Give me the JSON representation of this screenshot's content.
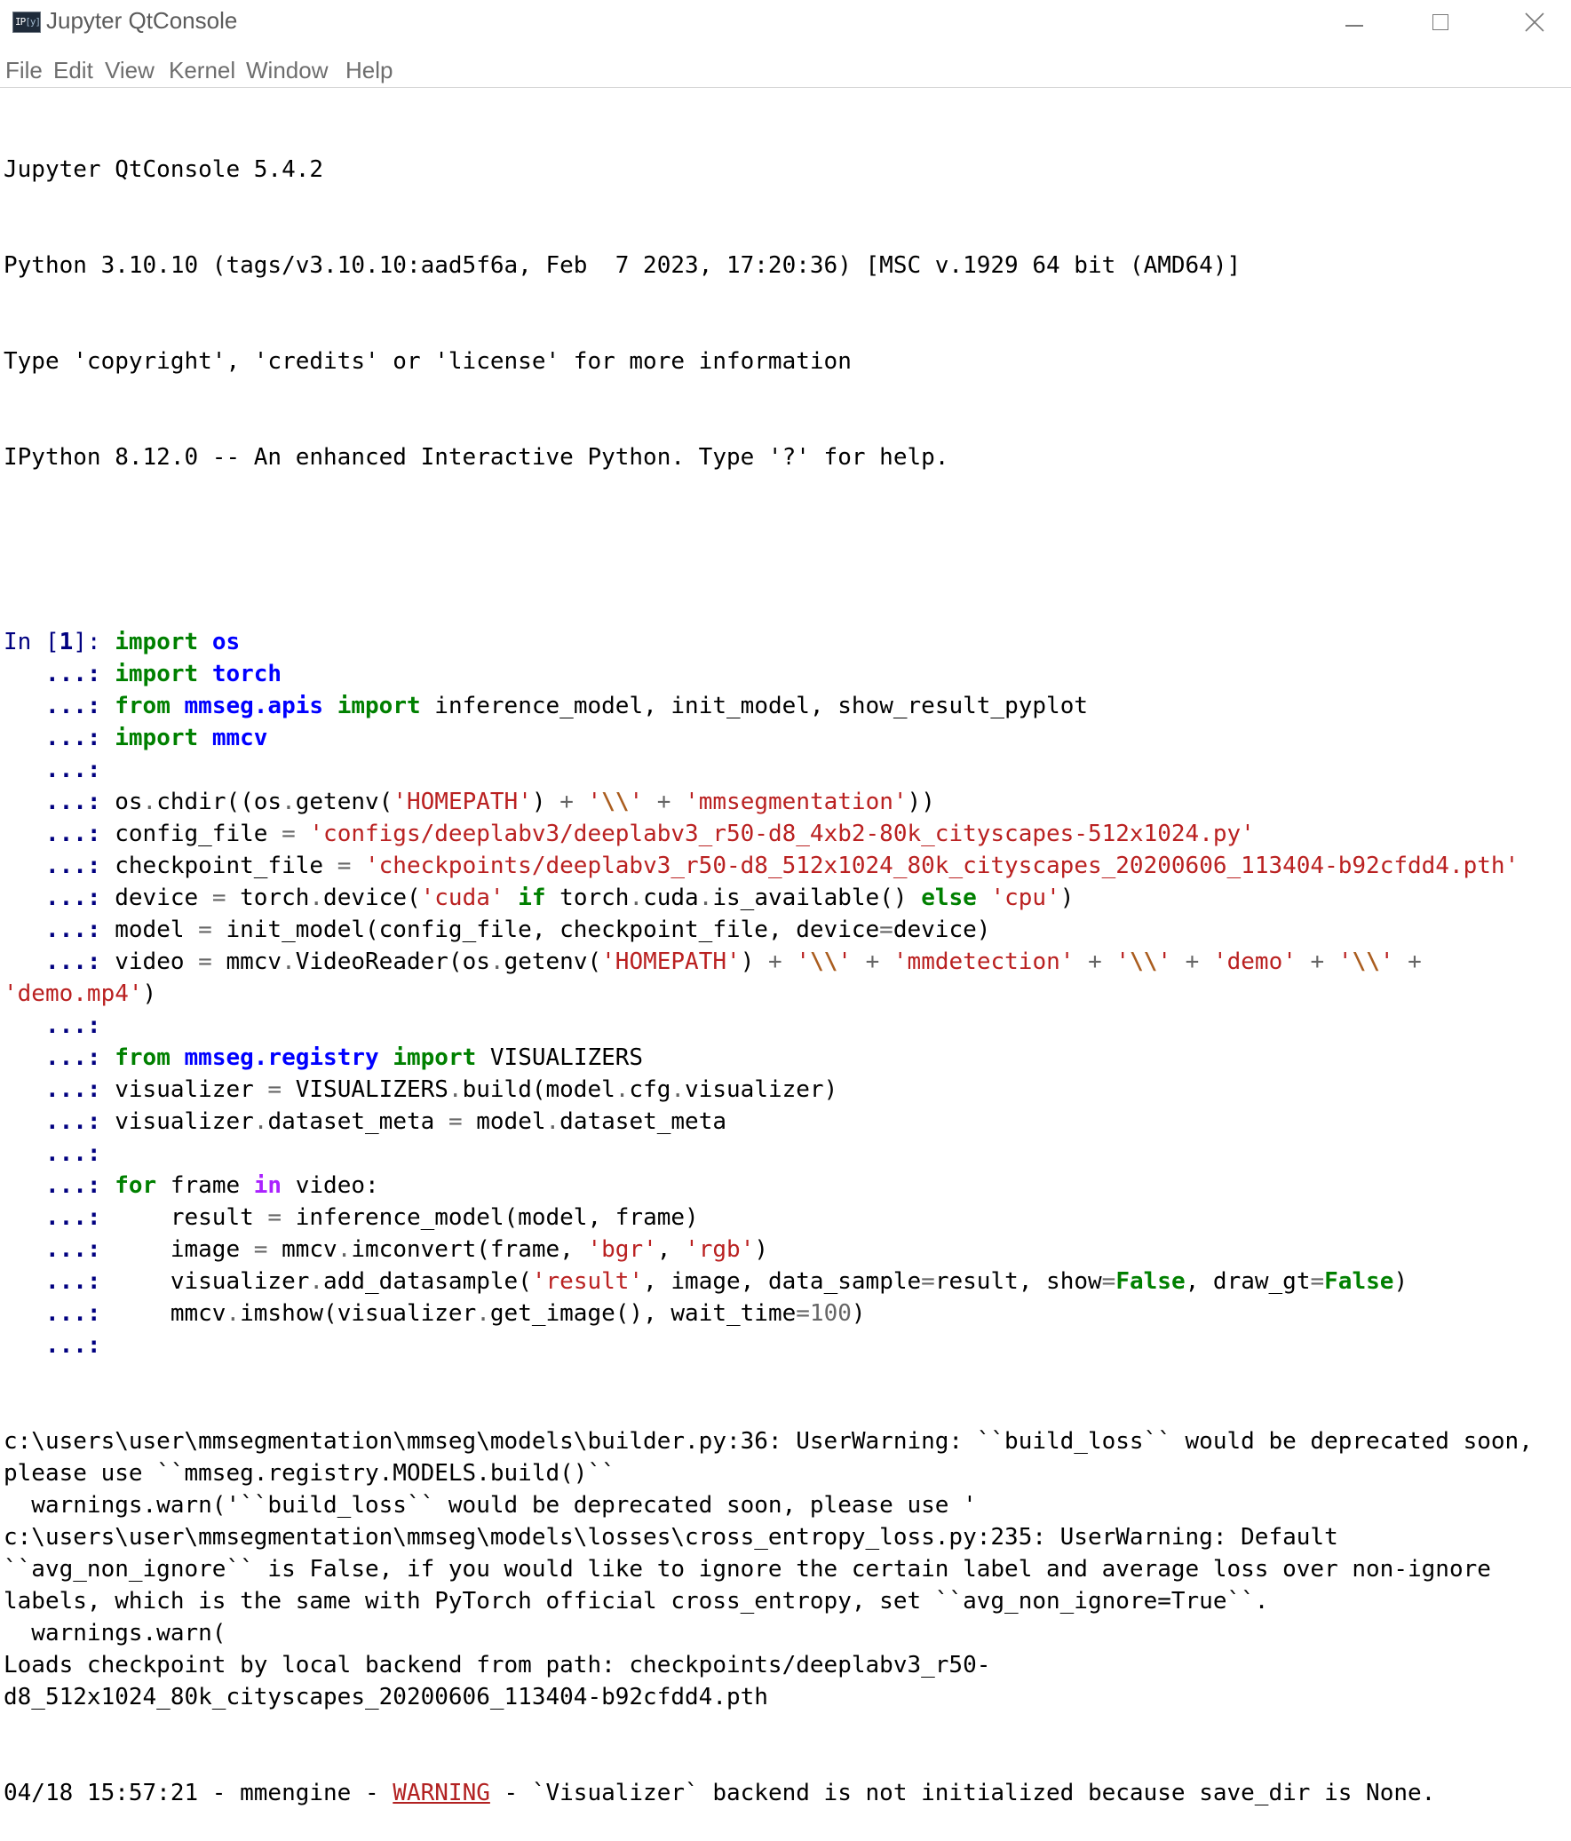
{
  "window": {
    "title": "Jupyter QtConsole",
    "icon_text": "IP",
    "icon_text_py": "[y]",
    "icon_name": "ipython-app-icon",
    "controls": [
      "minimize-icon",
      "maximize-icon",
      "close-icon"
    ]
  },
  "menu": {
    "items": [
      "File",
      "Edit",
      "View",
      "Kernel",
      "Window",
      "Help"
    ]
  },
  "banner": [
    "Jupyter QtConsole 5.4.2",
    "Python 3.10.10 (tags/v3.10.10:aad5f6a, Feb  7 2023, 17:20:36) [MSC v.1929 64 bit (AMD64)]",
    "Type 'copyright', 'credits' or 'license' for more information",
    "IPython 8.12.0 -- An enhanced Interactive Python. Type '?' for help."
  ],
  "prompt": {
    "in_label": "In [",
    "in_number": "1",
    "in_close": "]: ",
    "continuation": "   ...: "
  },
  "code_lines": [
    [
      [
        "kw",
        "import"
      ],
      [
        "t",
        " "
      ],
      [
        "nn",
        "os"
      ]
    ],
    [
      [
        "kw",
        "import"
      ],
      [
        "t",
        " "
      ],
      [
        "nn",
        "torch"
      ]
    ],
    [
      [
        "kw",
        "from"
      ],
      [
        "t",
        " "
      ],
      [
        "nn",
        "mmseg.apis"
      ],
      [
        "t",
        " "
      ],
      [
        "kw",
        "import"
      ],
      [
        "t",
        " inference_model, init_model, show_result_pyplot"
      ]
    ],
    [
      [
        "kw",
        "import"
      ],
      [
        "t",
        " "
      ],
      [
        "nn",
        "mmcv"
      ]
    ],
    [],
    [
      [
        "t",
        "os"
      ],
      [
        "o",
        "."
      ],
      [
        "t",
        "chdir((os"
      ],
      [
        "o",
        "."
      ],
      [
        "t",
        "getenv("
      ],
      [
        "s",
        "'HOMEPATH'"
      ],
      [
        "t",
        ") "
      ],
      [
        "o",
        "+"
      ],
      [
        "t",
        " "
      ],
      [
        "s",
        "'"
      ],
      [
        "se",
        "\\\\"
      ],
      [
        "s",
        "'"
      ],
      [
        "t",
        " "
      ],
      [
        "o",
        "+"
      ],
      [
        "t",
        " "
      ],
      [
        "s",
        "'mmsegmentation'"
      ],
      [
        "t",
        "))"
      ]
    ],
    [
      [
        "t",
        "config_file "
      ],
      [
        "o",
        "="
      ],
      [
        "t",
        " "
      ],
      [
        "s",
        "'configs/deeplabv3/deeplabv3_r50-d8_4xb2-80k_cityscapes-512x1024.py'"
      ]
    ],
    [
      [
        "t",
        "checkpoint_file "
      ],
      [
        "o",
        "="
      ],
      [
        "t",
        " "
      ],
      [
        "s",
        "'checkpoints/deeplabv3_r50-d8_512x1024_80k_cityscapes_20200606_113404-b92cfdd4.pth'"
      ]
    ],
    [
      [
        "t",
        "device "
      ],
      [
        "o",
        "="
      ],
      [
        "t",
        " torch"
      ],
      [
        "o",
        "."
      ],
      [
        "t",
        "device("
      ],
      [
        "s",
        "'cuda'"
      ],
      [
        "t",
        " "
      ],
      [
        "kw",
        "if"
      ],
      [
        "t",
        " torch"
      ],
      [
        "o",
        "."
      ],
      [
        "t",
        "cuda"
      ],
      [
        "o",
        "."
      ],
      [
        "t",
        "is_available() "
      ],
      [
        "kw",
        "else"
      ],
      [
        "t",
        " "
      ],
      [
        "s",
        "'cpu'"
      ],
      [
        "t",
        ")"
      ]
    ],
    [
      [
        "t",
        "model "
      ],
      [
        "o",
        "="
      ],
      [
        "t",
        " init_model(config_file, checkpoint_file, device"
      ],
      [
        "o",
        "="
      ],
      [
        "t",
        "device)"
      ]
    ],
    [
      [
        "t",
        "video "
      ],
      [
        "o",
        "="
      ],
      [
        "t",
        " mmcv"
      ],
      [
        "o",
        "."
      ],
      [
        "t",
        "VideoReader(os"
      ],
      [
        "o",
        "."
      ],
      [
        "t",
        "getenv("
      ],
      [
        "s",
        "'HOMEPATH'"
      ],
      [
        "t",
        ") "
      ],
      [
        "o",
        "+"
      ],
      [
        "t",
        " "
      ],
      [
        "s",
        "'"
      ],
      [
        "se",
        "\\\\"
      ],
      [
        "s",
        "'"
      ],
      [
        "t",
        " "
      ],
      [
        "o",
        "+"
      ],
      [
        "t",
        " "
      ],
      [
        "s",
        "'mmdetection'"
      ],
      [
        "t",
        " "
      ],
      [
        "o",
        "+"
      ],
      [
        "t",
        " "
      ],
      [
        "s",
        "'"
      ],
      [
        "se",
        "\\\\"
      ],
      [
        "s",
        "'"
      ],
      [
        "t",
        " "
      ],
      [
        "o",
        "+"
      ],
      [
        "t",
        " "
      ],
      [
        "s",
        "'demo'"
      ],
      [
        "t",
        " "
      ],
      [
        "o",
        "+"
      ],
      [
        "t",
        " "
      ],
      [
        "s",
        "'"
      ],
      [
        "se",
        "\\\\"
      ],
      [
        "s",
        "'"
      ],
      [
        "t",
        " "
      ],
      [
        "o",
        "+"
      ]
    ],
    [],
    [
      [
        "kw",
        "from"
      ],
      [
        "t",
        " "
      ],
      [
        "nn",
        "mmseg.registry"
      ],
      [
        "t",
        " "
      ],
      [
        "kw",
        "import"
      ],
      [
        "t",
        " VISUALIZERS"
      ]
    ],
    [
      [
        "t",
        "visualizer "
      ],
      [
        "o",
        "="
      ],
      [
        "t",
        " VISUALIZERS"
      ],
      [
        "o",
        "."
      ],
      [
        "t",
        "build(model"
      ],
      [
        "o",
        "."
      ],
      [
        "t",
        "cfg"
      ],
      [
        "o",
        "."
      ],
      [
        "t",
        "visualizer)"
      ]
    ],
    [
      [
        "t",
        "visualizer"
      ],
      [
        "o",
        "."
      ],
      [
        "t",
        "dataset_meta "
      ],
      [
        "o",
        "="
      ],
      [
        "t",
        " model"
      ],
      [
        "o",
        "."
      ],
      [
        "t",
        "dataset_meta"
      ]
    ],
    [],
    [
      [
        "kw",
        "for"
      ],
      [
        "t",
        " frame "
      ],
      [
        "ow",
        "in"
      ],
      [
        "t",
        " video:"
      ]
    ],
    [
      [
        "t",
        "    result "
      ],
      [
        "o",
        "="
      ],
      [
        "t",
        " inference_model(model, frame)"
      ]
    ],
    [
      [
        "t",
        "    image "
      ],
      [
        "o",
        "="
      ],
      [
        "t",
        " mmcv"
      ],
      [
        "o",
        "."
      ],
      [
        "t",
        "imconvert(frame, "
      ],
      [
        "s",
        "'bgr'"
      ],
      [
        "t",
        ", "
      ],
      [
        "s",
        "'rgb'"
      ],
      [
        "t",
        ")"
      ]
    ],
    [
      [
        "t",
        "    visualizer"
      ],
      [
        "o",
        "."
      ],
      [
        "t",
        "add_datasample("
      ],
      [
        "s",
        "'result'"
      ],
      [
        "t",
        ", image, data_sample"
      ],
      [
        "o",
        "="
      ],
      [
        "t",
        "result, show"
      ],
      [
        "o",
        "="
      ],
      [
        "kw",
        "False"
      ],
      [
        "t",
        ", draw_gt"
      ],
      [
        "o",
        "="
      ],
      [
        "kw",
        "False"
      ],
      [
        "t",
        ")"
      ]
    ],
    [
      [
        "t",
        "    mmcv"
      ],
      [
        "o",
        "."
      ],
      [
        "t",
        "imshow(visualizer"
      ],
      [
        "o",
        "."
      ],
      [
        "t",
        "get_image(), wait_time"
      ],
      [
        "o",
        "="
      ],
      [
        "num",
        "100"
      ],
      [
        "t",
        ")"
      ]
    ],
    []
  ],
  "code_wrap_continuation": [
    [
      "s",
      "'demo.mp4'"
    ],
    [
      "t",
      ")"
    ]
  ],
  "output": [
    "c:\\users\\user\\mmsegmentation\\mmseg\\models\\builder.py:36: UserWarning: ``build_loss`` would be deprecated soon,",
    "please use ``mmseg.registry.MODELS.build()``",
    "  warnings.warn('``build_loss`` would be deprecated soon, please use '",
    "c:\\users\\user\\mmsegmentation\\mmseg\\models\\losses\\cross_entropy_loss.py:235: UserWarning: Default",
    "``avg_non_ignore`` is False, if you would like to ignore the certain label and average loss over non-ignore",
    "labels, which is the same with PyTorch official cross_entropy, set ``avg_non_ignore=True``.",
    "  warnings.warn(",
    "Loads checkpoint by local backend from path: checkpoints/deeplabv3_r50-",
    "d8_512x1024_80k_cityscapes_20200606_113404-b92cfdd4.pth"
  ],
  "log_line": {
    "prefix": "04/18 15:57:21 - mmengine - ",
    "level": "WARNING",
    "message": " - `Visualizer` backend is not initialized because save_dir is None."
  }
}
